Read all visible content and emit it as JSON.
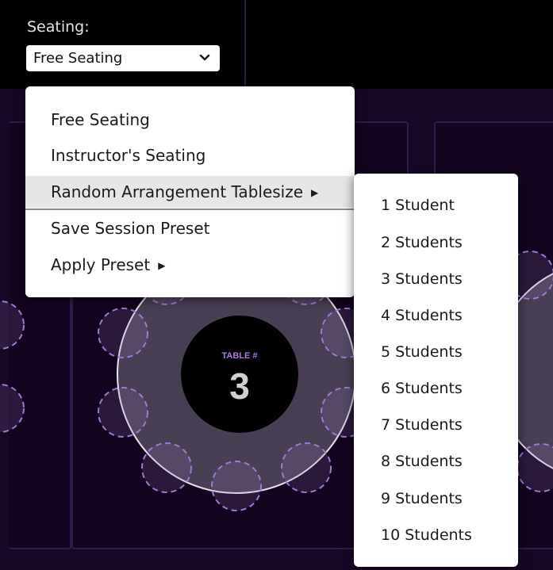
{
  "seating": {
    "label": "Seating:",
    "selected": "Free Seating"
  },
  "menu": {
    "items": [
      {
        "label": "Free Seating"
      },
      {
        "label": "Instructor's Seating"
      },
      {
        "label": "Random Arrangement Tablesize",
        "submenu": true
      },
      {
        "label": "Save Session Preset"
      },
      {
        "label": "Apply Preset",
        "submenu": true
      }
    ]
  },
  "submenu": {
    "items": [
      "1 Student",
      "2 Students",
      "3 Students",
      "4 Students",
      "5 Students",
      "6 Students",
      "7 Students",
      "8 Students",
      "9 Students",
      "10 Students"
    ]
  },
  "table": {
    "caption": "TABLE #",
    "number": "3"
  },
  "colors": {
    "accent_purple": "#a97de0",
    "background": "#170726"
  }
}
